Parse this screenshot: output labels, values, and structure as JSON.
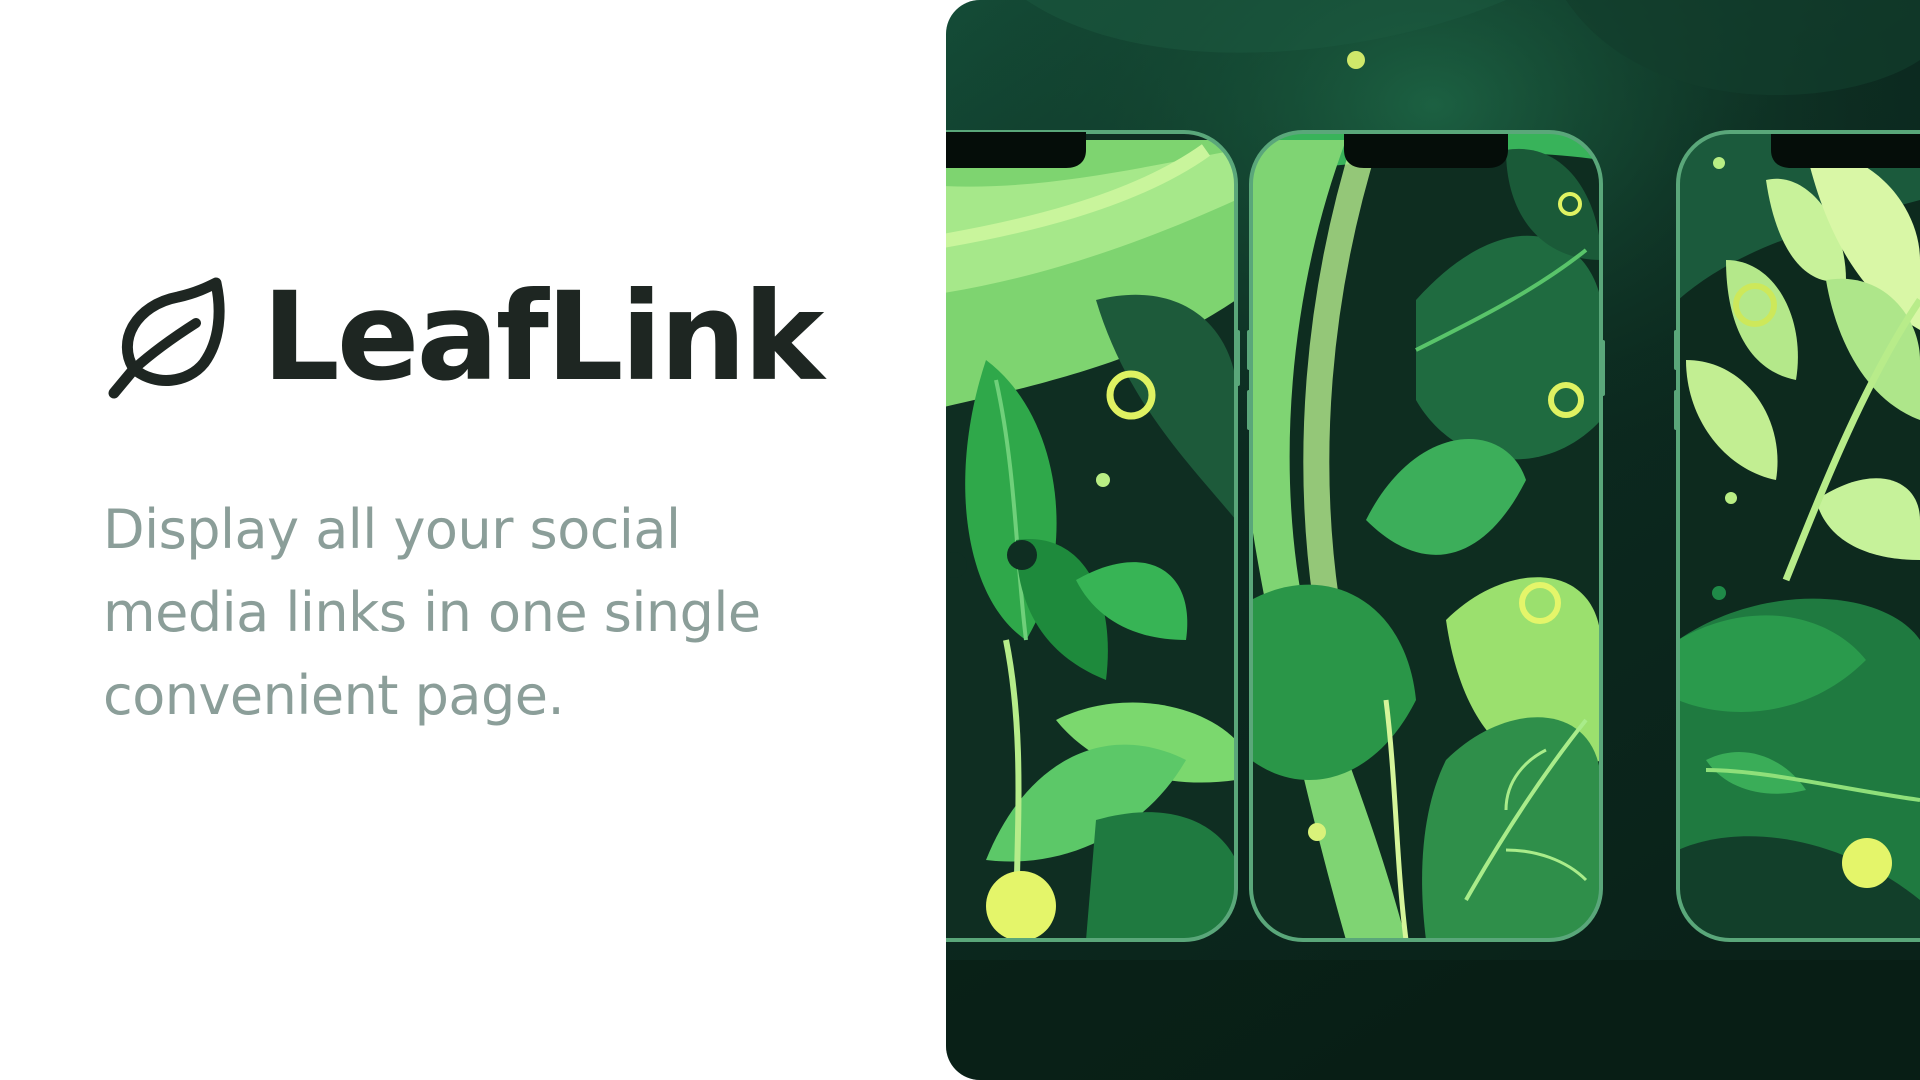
{
  "brand": {
    "name": "LeafLink",
    "logo_icon": "leaf-icon",
    "text_color": "#1e2622"
  },
  "hero": {
    "tagline": "Display all your social media links in one single convenient page.",
    "tagline_color": "#8b9e99"
  },
  "preview": {
    "phone_count": 3,
    "palette": {
      "background": "#0e2a1f",
      "frame": "#5aa77a",
      "leaf_light": "#b9ee84",
      "leaf_mid": "#4cb85a",
      "leaf_dark": "#1a6b3a",
      "accent": "#e4f56a"
    }
  }
}
